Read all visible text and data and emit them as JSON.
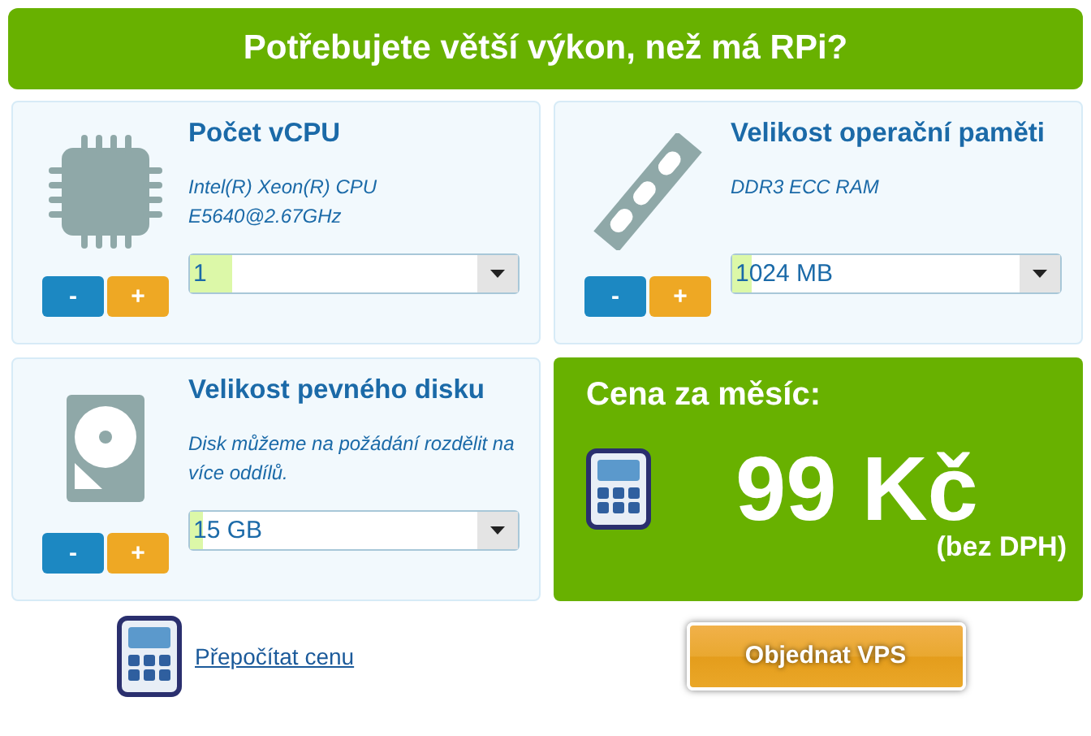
{
  "header": {
    "title": "Potřebujete větší výkon, než má RPi?"
  },
  "options": [
    {
      "kind": "cpu",
      "title": "Počet vCPU",
      "description": "Intel(R) Xeon(R) CPU E5640@2.67GHz",
      "minus": "-",
      "plus": "+",
      "value": "1",
      "level": 0.13
    },
    {
      "kind": "ram",
      "title": "Velikost operační paměti",
      "description": "DDR3 ECC RAM",
      "minus": "-",
      "plus": "+",
      "value": "1024 MB",
      "level": 0.06
    },
    {
      "kind": "disk",
      "title": "Velikost pevného disku",
      "description": "Disk můžeme na požádání rozdělit na více oddílů.",
      "minus": "-",
      "plus": "+",
      "value": "15 GB",
      "level": 0.04
    }
  ],
  "price": {
    "label": "Cena za měsíc:",
    "amount": "99 Kč",
    "note": "(bez DPH)"
  },
  "recalculate_link": "Přepočítat cenu",
  "order_button": "Objednat VPS"
}
